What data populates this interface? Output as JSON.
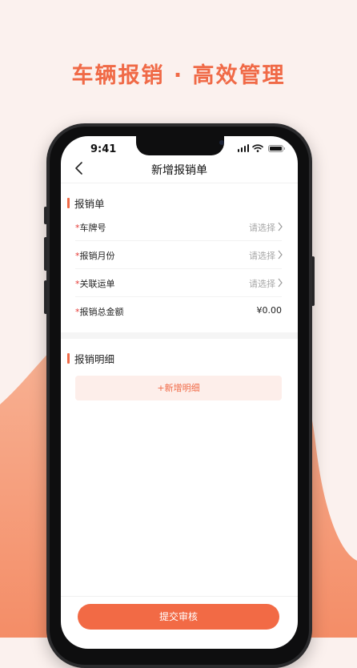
{
  "headline": "车辆报销 · 高效管理",
  "status": {
    "time": "9:41"
  },
  "nav": {
    "title": "新增报销单"
  },
  "form": {
    "section_title": "报销单",
    "required_mark": "*",
    "fields": [
      {
        "label": "车牌号",
        "placeholder": "请选择"
      },
      {
        "label": "报销月份",
        "placeholder": "请选择"
      },
      {
        "label": "关联运单",
        "placeholder": "请选择"
      },
      {
        "label": "报销总金额",
        "value": "¥0.00"
      }
    ]
  },
  "detail": {
    "section_title": "报销明细",
    "add_label": "+新增明细"
  },
  "submit_label": "提交审核",
  "colors": {
    "accent": "#f06a47",
    "background": "#fbf1ee",
    "wave": "#f7a37f"
  },
  "icons": [
    "back-chevron-icon",
    "signal-icon",
    "wifi-icon",
    "battery-icon",
    "chevron-right-icon"
  ]
}
